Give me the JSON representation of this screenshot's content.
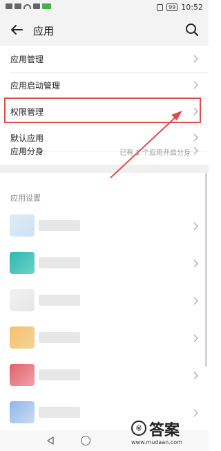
{
  "status_bar": {
    "time": "10:52",
    "battery": "99"
  },
  "header": {
    "title": "应用"
  },
  "menu": {
    "items": [
      {
        "label": "应用管理",
        "value": ""
      },
      {
        "label": "应用启动管理",
        "value": ""
      },
      {
        "label": "权限管理",
        "value": ""
      },
      {
        "label": "默认应用",
        "value": ""
      },
      {
        "label": "应用分身",
        "value": "已有 1 个应用开启分身"
      }
    ]
  },
  "app_settings": {
    "title": "应用设置"
  },
  "watermark": {
    "text": "答案",
    "url": "www.mudaan.com"
  },
  "colors": {
    "highlight": "#e24a4a",
    "accent": "#44b04a"
  }
}
